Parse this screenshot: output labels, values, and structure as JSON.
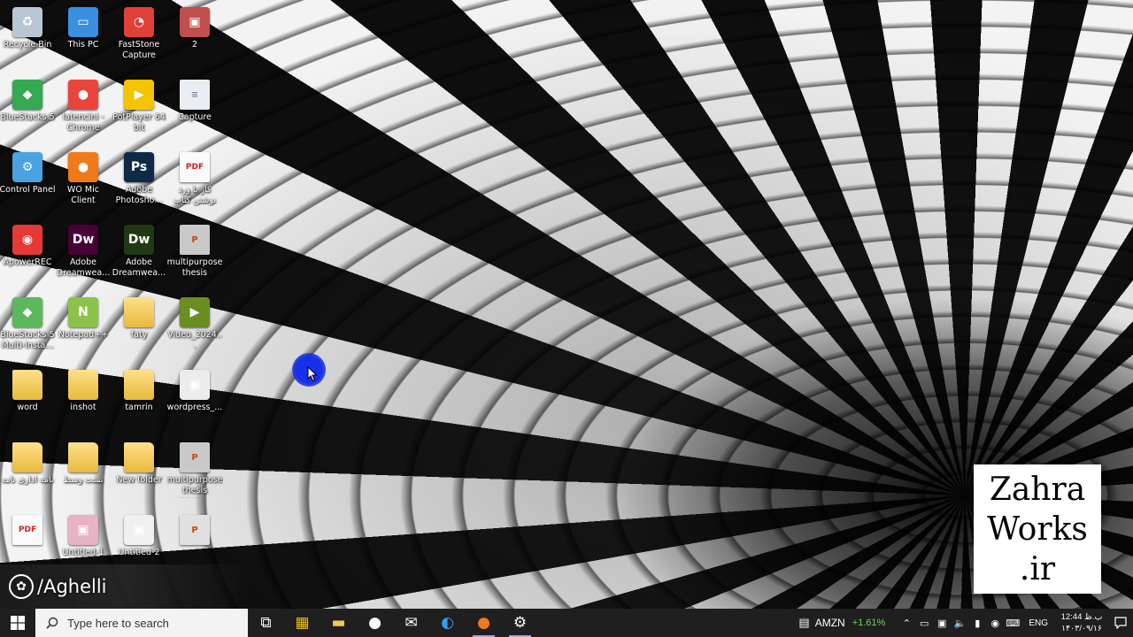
{
  "desktop": {
    "icons": [
      {
        "label": "Recycle Bin",
        "icon": "recycle-bin-icon",
        "glyph": "♻",
        "color": "#b9c7d4"
      },
      {
        "label": "This PC",
        "icon": "monitor-icon",
        "glyph": "▭",
        "color": "#3a8fe0"
      },
      {
        "label": "FastStone Capture",
        "icon": "faststone-capture-icon",
        "glyph": "◔",
        "color": "#e04038"
      },
      {
        "label": "2",
        "icon": "image-file-icon",
        "glyph": "▣",
        "color": "#c0504d"
      },
      {
        "label": "BlueStacks 5",
        "icon": "bluestacks-icon",
        "glyph": "◆",
        "color": "#34a853"
      },
      {
        "label": "latencini - Chrome",
        "icon": "chrome-icon",
        "glyph": "●",
        "color": "#e8453c"
      },
      {
        "label": "PotPlayer 64 bit",
        "icon": "potplayer-icon",
        "glyph": "▶",
        "color": "#f5c400"
      },
      {
        "label": "Capture",
        "icon": "document-icon",
        "glyph": "≡",
        "color": "#e8eef4"
      },
      {
        "label": "Control Panel",
        "icon": "control-panel-icon",
        "glyph": "⚙",
        "color": "#4aa3e0"
      },
      {
        "label": "WO Mic Client",
        "icon": "microphone-icon",
        "glyph": "●",
        "color": "#f07a1a"
      },
      {
        "label": "Adobe Photosho...",
        "icon": "photoshop-icon",
        "glyph": "Ps",
        "color": "#0e2a47"
      },
      {
        "label": "کار با ورد نوشتن کتاب",
        "icon": "pdf-icon",
        "glyph": "PDF",
        "color": "#fafafa"
      },
      {
        "label": "ApowerREC",
        "icon": "apowerrec-icon",
        "glyph": "◉",
        "color": "#e53935"
      },
      {
        "label": "Adobe Dreamwea...",
        "icon": "dreamweaver-icon",
        "glyph": "Dw",
        "color": "#470137"
      },
      {
        "label": "Adobe Dreamwea...",
        "icon": "dreamweaver-icon",
        "glyph": "Dw",
        "color": "#1f3a12"
      },
      {
        "label": "multipurpose thesis powe...",
        "icon": "powerpoint-file-icon",
        "glyph": "P",
        "color": "#c9c9c9"
      },
      {
        "label": "BlueStacks 5 Multi-Insta...",
        "icon": "bluestacks-multi-icon",
        "glyph": "◆",
        "color": "#5cb85c"
      },
      {
        "label": "Notepad++",
        "icon": "notepad-plus-plus-icon",
        "glyph": "N",
        "color": "#8bc34a"
      },
      {
        "label": "faty",
        "icon": "folder-icon",
        "glyph": "",
        "color": "#f0c24a"
      },
      {
        "label": "Video_2024...",
        "icon": "video-file-icon",
        "glyph": "▶",
        "color": "#6b8e23"
      },
      {
        "label": "word",
        "icon": "folder-icon",
        "glyph": "",
        "color": "#f0c24a"
      },
      {
        "label": "inshot",
        "icon": "folder-icon",
        "glyph": "",
        "color": "#f0c24a"
      },
      {
        "label": "tamrin",
        "icon": "folder-icon",
        "glyph": "",
        "color": "#f0c24a"
      },
      {
        "label": "wordpress_...",
        "icon": "image-file-icon",
        "glyph": "▣",
        "color": "#ececec"
      },
      {
        "label": "نامه اداری نامه",
        "icon": "folder-icon",
        "glyph": "",
        "color": "#f0c24a"
      },
      {
        "label": "تست وسط",
        "icon": "folder-icon",
        "glyph": "",
        "color": "#f0c24a"
      },
      {
        "label": "New folder",
        "icon": "folder-icon",
        "glyph": "",
        "color": "#f0c24a"
      },
      {
        "label": "multipurpose thesis powe...",
        "icon": "powerpoint-file-icon",
        "glyph": "P",
        "color": "#c9c9c9"
      },
      {
        "label": "",
        "icon": "pdf-icon",
        "glyph": "PDF",
        "color": "#fafafa"
      },
      {
        "label": "Untitled-1",
        "icon": "image-file-icon",
        "glyph": "▣",
        "color": "#e9b3c6"
      },
      {
        "label": "Untitled-2",
        "icon": "image-file-icon",
        "glyph": "▣",
        "color": "#f0f0f0"
      },
      {
        "label": "",
        "icon": "powerpoint-file-icon",
        "glyph": "P",
        "color": "#e0e0e0"
      }
    ]
  },
  "overlay": {
    "channel": "/Aghelli",
    "brand_lines": [
      "Zahra",
      "Works",
      ".ir"
    ]
  },
  "taskbar": {
    "search_placeholder": "Type here to search",
    "apps": [
      {
        "name": "task-view-icon",
        "glyph": "⧉",
        "color": "#ffffff",
        "active": false
      },
      {
        "name": "store-icon",
        "glyph": "▦",
        "color": "#f2c200",
        "active": false
      },
      {
        "name": "file-explorer-icon",
        "glyph": "▬",
        "color": "#f2c94c",
        "active": false
      },
      {
        "name": "media-app-icon",
        "glyph": "●",
        "color": "#ffffff",
        "active": false
      },
      {
        "name": "mail-icon",
        "glyph": "✉",
        "color": "#ffffff",
        "active": false
      },
      {
        "name": "edge-icon",
        "glyph": "◐",
        "color": "#2fa0e8",
        "active": false
      },
      {
        "name": "microphone-icon",
        "glyph": "●",
        "color": "#f07a1a",
        "active": true
      },
      {
        "name": "settings-icon",
        "glyph": "⚙",
        "color": "#ffffff",
        "active": true
      }
    ],
    "ticker_symbol": "AMZN",
    "ticker_change": "+1.61%",
    "language": "ENG",
    "clock_time": "12:44 ب.ظ",
    "clock_date": "۱۴۰۳/۰۹/۱۶"
  }
}
